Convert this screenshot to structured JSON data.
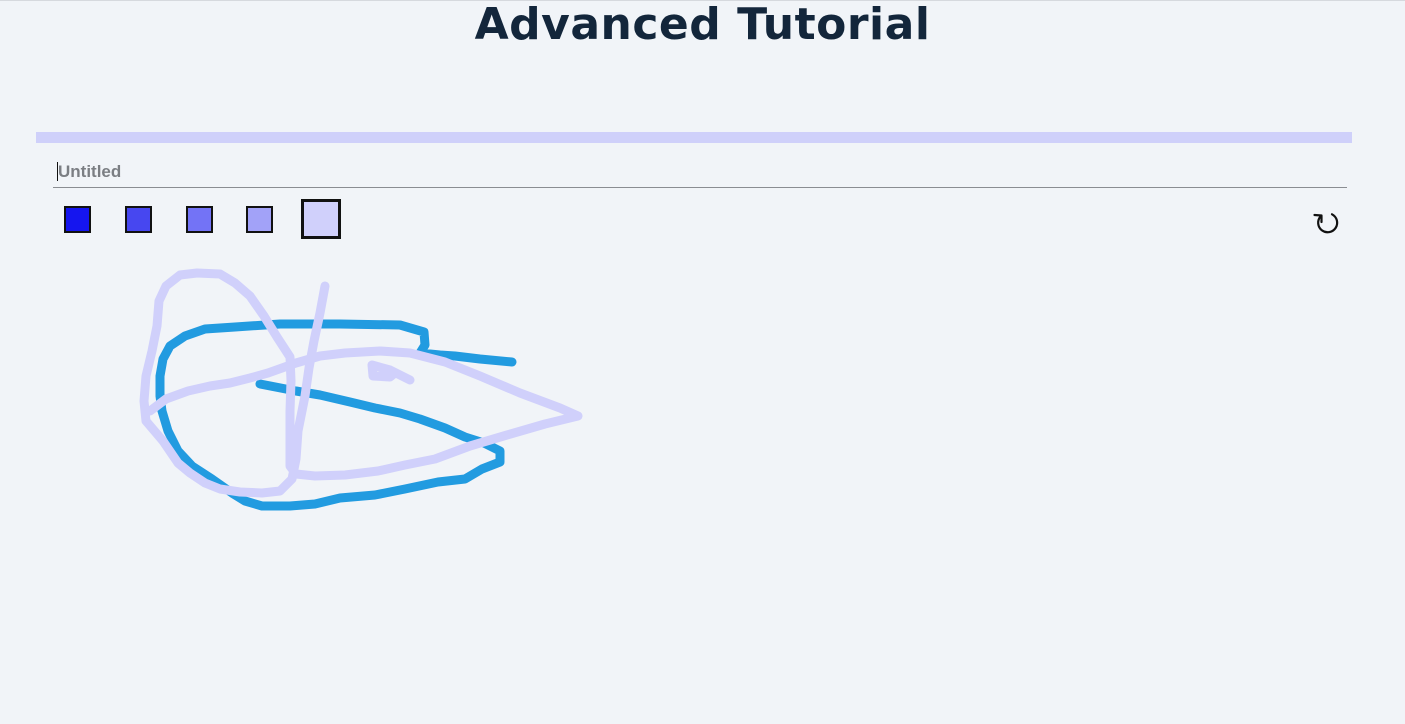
{
  "page": {
    "title": "Advanced Tutorial"
  },
  "drawing_title": {
    "value": "",
    "placeholder": "Untitled"
  },
  "palette": {
    "swatches": [
      {
        "name": "color-1",
        "color": "#1515ef"
      },
      {
        "name": "color-2",
        "color": "#4747f0"
      },
      {
        "name": "color-3",
        "color": "#7373f6"
      },
      {
        "name": "color-4",
        "color": "#a2a2f8"
      },
      {
        "name": "color-5",
        "color": "#d0d0fb",
        "selected": true
      }
    ],
    "header_bar_color": "#cfd0fa"
  },
  "toolbar": {
    "undo_icon": "undo-icon"
  },
  "strokes": [
    {
      "color": "#229be0"
    },
    {
      "color": "#d0d0fb"
    },
    {
      "color": "#d0d0fb"
    }
  ]
}
